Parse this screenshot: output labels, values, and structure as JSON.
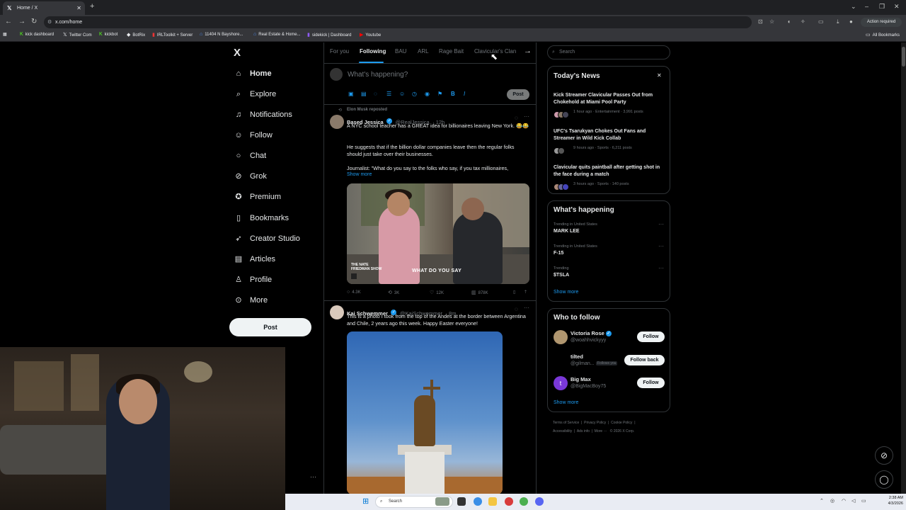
{
  "browser": {
    "tab_title": "Home / X",
    "url": "x.com/home",
    "action_required": "Action required",
    "all_bookmarks": "All Bookmarks",
    "bookmarks": [
      "kick dashboard",
      "Twitter Com",
      "kickbot",
      "BotRix",
      "IRLToolkit + Server",
      "11404 N Bayshore...",
      "Real Estate & Home...",
      "sidekick | Dashboard",
      "Youtube"
    ]
  },
  "nav": {
    "logo": "X",
    "items": [
      "Home",
      "Explore",
      "Notifications",
      "Follow",
      "Chat",
      "Grok",
      "Premium",
      "Bookmarks",
      "Creator Studio",
      "Articles",
      "Profile",
      "More"
    ],
    "post_button": "Post"
  },
  "feed": {
    "tabs": [
      "For you",
      "Following",
      "BAU",
      "ARL",
      "Rage Bait",
      "Clavicular's Clan"
    ],
    "compose_placeholder": "What's happening?",
    "compose_post": "Post",
    "tweets": [
      {
        "repost_label": "Elon Musk reposted",
        "name": "Based Jessica",
        "handle": "@RealJessica",
        "time": "· 12h",
        "text1": "A NYC school teacher has a GREAT idea for billionaires leaving New York. 😂😂",
        "text2": "He suggests that if the billion dollar companies leave then the regular folks should just take over their businesses.",
        "text3": "Journalist: \"What do you say to the folks who say, if you tax millionaires,",
        "show_more": "Show more",
        "media_caption": "WHAT DO YOU SAY",
        "media_logo": "THE NATE FRIEDMAN SHOW",
        "replies": "4.3K",
        "reposts": "3K",
        "likes": "12K",
        "views": "878K"
      },
      {
        "name": "Kai Schwemmer",
        "handle": "@KaiSchwemmer",
        "time": "· 8m",
        "text1": "This is a photo I took from the top of the Andes at the border between Argentina and Chile, 2 years ago this week. Happy Easter everyone!"
      }
    ]
  },
  "sidebar": {
    "search_placeholder": "Search",
    "news": {
      "title": "Today's News",
      "items": [
        {
          "headline": "Kick Streamer Clavicular Passes Out from Chokehold at Miami Pool Party",
          "meta": "1 hour ago · Entertainment · 3,991 posts"
        },
        {
          "headline": "UFC's Tsarukyan Chokes Out Fans and Streamer in Wild Kick Collab",
          "meta": "9 hours ago · Sports · 6,211 posts"
        },
        {
          "headline": "Clavicular quits paintball after getting shot in the face during a match",
          "meta": "3 hours ago · Sports · 140 posts"
        }
      ]
    },
    "happening": {
      "title": "What's happening",
      "items": [
        {
          "context": "Trending in United States",
          "name": "MARK LEE"
        },
        {
          "context": "Trending in United States",
          "name": "F-15"
        },
        {
          "context": "Trending",
          "name": "$TSLA"
        }
      ],
      "show_more": "Show more"
    },
    "who_to_follow": {
      "title": "Who to follow",
      "items": [
        {
          "name": "Victoria Rose",
          "handle": "@woahhvickyyy",
          "button": "Follow",
          "badge": ""
        },
        {
          "name": "tilted",
          "handle": "@gilman...",
          "button": "Follow back",
          "badge": "Follows you"
        },
        {
          "name": "Big Max",
          "handle": "@BigMacBoy75",
          "button": "Follow",
          "badge": "",
          "initial": "t"
        }
      ],
      "show_more": "Show more"
    },
    "footer_line1": [
      "Terms of Service",
      "|",
      "Privacy Policy",
      "|",
      "Cookie Policy",
      "|"
    ],
    "footer_line2": [
      "Accessibility",
      "|",
      "Ads info",
      "|",
      "More ···",
      "© 2026 X Corp."
    ]
  },
  "taskbar": {
    "search": "Search",
    "time": "2:38 AM",
    "date": "4/3/2026"
  },
  "colors": {
    "accent": "#1d9bf0",
    "background": "#000000",
    "border": "#2f3336"
  }
}
